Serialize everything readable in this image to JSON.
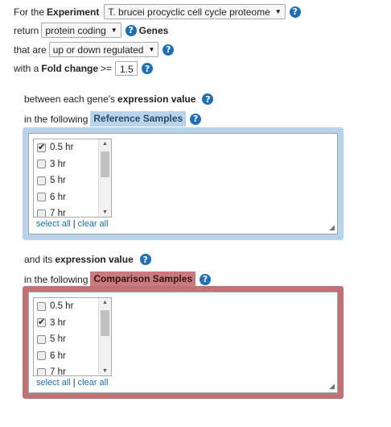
{
  "experiment": {
    "label": "For the",
    "bold": "Experiment",
    "value": "T. brucei procyclic cell cycle proteome"
  },
  "return": {
    "label": "return",
    "value": "protein coding",
    "suffix": "Genes"
  },
  "direction": {
    "label": "that are",
    "value": "up or down regulated"
  },
  "fold": {
    "label_pre": "with a",
    "label_bold": "Fold change",
    "label_op": ">=",
    "value": "1.5"
  },
  "reference": {
    "line1_pre": "between each gene's",
    "line1_bold": "expression value",
    "line2": "in the following",
    "tab": "Reference Samples",
    "items": [
      {
        "label": "0.5 hr",
        "checked": true
      },
      {
        "label": "3 hr",
        "checked": false
      },
      {
        "label": "5 hr",
        "checked": false
      },
      {
        "label": "6 hr",
        "checked": false
      },
      {
        "label": "7 hr",
        "checked": false
      }
    ]
  },
  "comparison": {
    "line1_pre": "and its",
    "line1_bold": "expression value",
    "line2": "in the following",
    "tab": "Comparison Samples",
    "items": [
      {
        "label": "0.5 hr",
        "checked": false
      },
      {
        "label": "3 hr",
        "checked": true
      },
      {
        "label": "5 hr",
        "checked": false
      },
      {
        "label": "6 hr",
        "checked": false
      },
      {
        "label": "7 hr",
        "checked": false
      }
    ]
  },
  "links": {
    "select_all": "select all",
    "separator": "|",
    "clear_all": "clear all"
  },
  "help_glyph": "?"
}
